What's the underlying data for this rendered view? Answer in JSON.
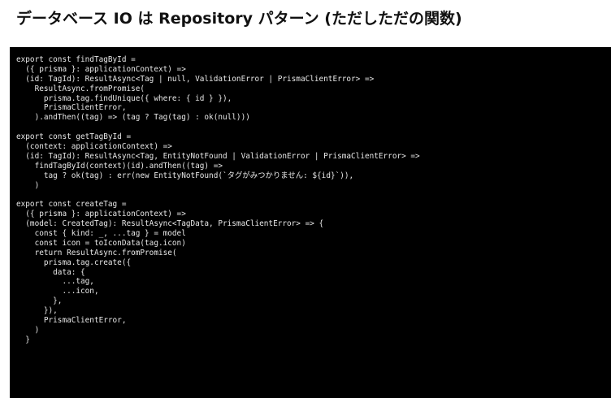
{
  "slide": {
    "title": "データベース IO は Repository パターン (ただしただの関数)"
  },
  "code": {
    "lines": [
      "export const findTagById =",
      "  ({ prisma }: applicationContext) =>",
      "  (id: TagId): ResultAsync<Tag | null, ValidationError | PrismaClientError> =>",
      "    ResultAsync.fromPromise(",
      "      prisma.tag.findUnique({ where: { id } }),",
      "      PrismaClientError,",
      "    ).andThen((tag) => (tag ? Tag(tag) : ok(null)))",
      "",
      "export const getTagById =",
      "  (context: applicationContext) =>",
      "  (id: TagId): ResultAsync<Tag, EntityNotFound | ValidationError | PrismaClientError> =>",
      "    findTagById(context)(id).andThen((tag) =>",
      "      tag ? ok(tag) : err(new EntityNotFound(`タグがみつかりません: ${id}`)),",
      "    )",
      "",
      "export const createTag =",
      "  ({ prisma }: applicationContext) =>",
      "  (model: CreatedTag): ResultAsync<TagData, PrismaClientError> => {",
      "    const { kind: _, ...tag } = model",
      "    const icon = toIconData(tag.icon)",
      "    return ResultAsync.fromPromise(",
      "      prisma.tag.create({",
      "        data: {",
      "          ...tag,",
      "          ...icon,",
      "        },",
      "      }),",
      "      PrismaClientError,",
      "    )",
      "  }"
    ]
  }
}
